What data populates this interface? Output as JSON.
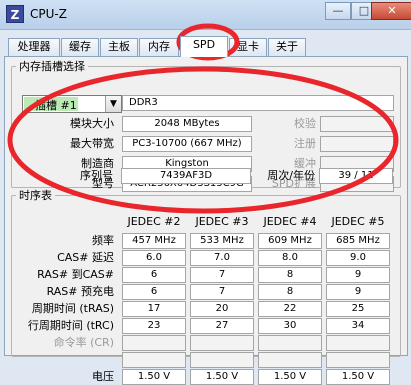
{
  "window": {
    "app_icon_letter": "Z",
    "title": "CPU-Z",
    "minimize": "—",
    "restore": "□",
    "close": "✕"
  },
  "tabs": [
    "处理器",
    "缓存",
    "主板",
    "内存",
    "SPD",
    "显卡",
    "关于"
  ],
  "active_tab": "SPD",
  "slot_section": {
    "legend": "内存插槽选择",
    "slot_value": "插槽 #1",
    "memory_type": "DDR3",
    "rows": [
      {
        "label": "模块大小",
        "value": "2048 MBytes",
        "right_label": "校验",
        "right_value": ""
      },
      {
        "label": "最大带宽",
        "value": "PC3-10700 (667 MHz)",
        "right_label": "注册",
        "right_value": ""
      },
      {
        "label": "制造商",
        "value": "Kingston",
        "right_label": "缓冲",
        "right_value": ""
      },
      {
        "label": "型号",
        "value": "ACR256X64D3S13C9G",
        "right_label": "SPD扩展",
        "right_value": ""
      },
      {
        "label": "序列号",
        "value": "7439AF3D",
        "right_label": "周次/年份",
        "right_value": "39 / 11"
      }
    ]
  },
  "timing_section": {
    "legend": "时序表",
    "columns": [
      "JEDEC #2",
      "JEDEC #3",
      "JEDEC #4",
      "JEDEC #5"
    ],
    "rows": [
      {
        "label": "频率",
        "dim": false,
        "values": [
          "457 MHz",
          "533 MHz",
          "609 MHz",
          "685 MHz"
        ]
      },
      {
        "label": "CAS# 延迟",
        "dim": false,
        "values": [
          "6.0",
          "7.0",
          "8.0",
          "9.0"
        ]
      },
      {
        "label": "RAS# 到CAS#",
        "dim": false,
        "values": [
          "6",
          "7",
          "8",
          "9"
        ]
      },
      {
        "label": "RAS# 预充电",
        "dim": false,
        "values": [
          "6",
          "7",
          "8",
          "9"
        ]
      },
      {
        "label": "周期时间 (tRAS)",
        "dim": false,
        "values": [
          "17",
          "20",
          "22",
          "25"
        ]
      },
      {
        "label": "行周期时间 (tRC)",
        "dim": false,
        "values": [
          "23",
          "27",
          "30",
          "34"
        ]
      },
      {
        "label": "命令率 (CR)",
        "dim": true,
        "values": [
          "",
          "",
          "",
          ""
        ]
      },
      {
        "label": "",
        "dim": true,
        "values": [
          "",
          "",
          "",
          ""
        ]
      },
      {
        "label": "电压",
        "dim": false,
        "values": [
          "1.50 V",
          "1.50 V",
          "1.50 V",
          "1.50 V"
        ]
      }
    ]
  },
  "colors": {
    "annotation_red": "#e8262b",
    "slot_highlight": "#a9e6a3"
  }
}
